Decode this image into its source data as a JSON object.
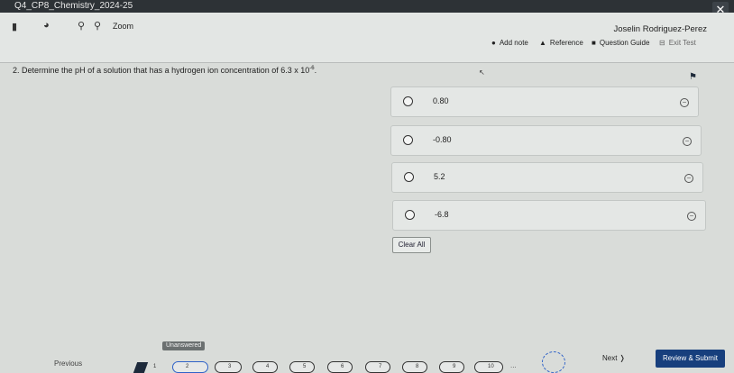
{
  "window": {
    "title": "Q4_CP8_Chemistry_2024-25",
    "close_label": "✕"
  },
  "toolbar": {
    "student_name": "Joselin Rodriguez-Perez",
    "zoom_label": "Zoom",
    "tools": [
      {
        "label": "Add note",
        "icon": "circle-plus-icon"
      },
      {
        "label": "Reference",
        "icon": "reference-icon"
      },
      {
        "label": "Question Guide",
        "icon": "guide-icon"
      },
      {
        "label": "Exit Test",
        "icon": "exit-icon"
      }
    ]
  },
  "question": {
    "number_text": "2.",
    "text": "Determine the pH of a solution that has a hydrogen ion concentration of 6.3 x 10",
    "exponent": "-6",
    "text_end": "."
  },
  "options": [
    {
      "label": "0.80"
    },
    {
      "label": "-0.80"
    },
    {
      "label": "5.2"
    },
    {
      "label": "-6.8"
    }
  ],
  "clear_all_label": "Clear All",
  "status_badge": "Unanswered",
  "navigation": {
    "previous_label": "Previous",
    "question_numbers": [
      "1",
      "2",
      "3",
      "4",
      "5",
      "6",
      "7",
      "8",
      "9",
      "10"
    ],
    "current_index": 2,
    "ellipsis": "...",
    "next_label": "Next",
    "submit_label": "Review & Submit"
  }
}
